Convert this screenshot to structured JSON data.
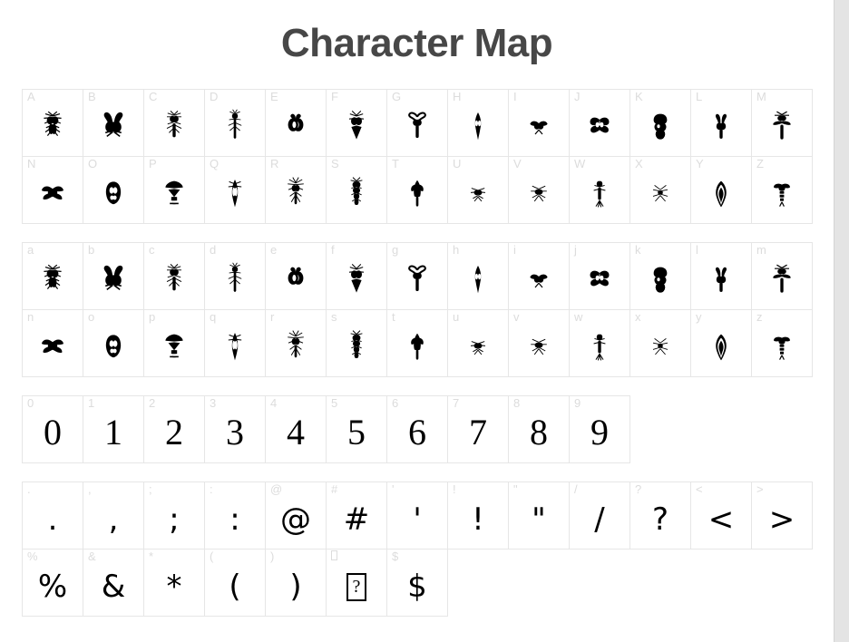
{
  "window": {
    "title": "Character Map"
  },
  "scrollbar": {
    "orientation": "vertical",
    "thumb_position_pct": 0,
    "thumb_size_pct": 100,
    "track_color": "#e4e4e4"
  },
  "colors": {
    "page_background": "#ffffff",
    "title_text": "#474747",
    "cell_border": "#e6e6e6",
    "cell_label": "#dcdcdc",
    "glyph": "#000000"
  },
  "blocks": [
    {
      "id": "uppercase",
      "name": "uppercase-letters",
      "style": "dingbat",
      "columns": 13,
      "rows": [
        [
          {
            "label": "A",
            "glyph": "A",
            "art": "ins-a"
          },
          {
            "label": "B",
            "glyph": "B",
            "art": "ins-b"
          },
          {
            "label": "C",
            "glyph": "C",
            "art": "ins-c"
          },
          {
            "label": "D",
            "glyph": "D",
            "art": "ins-d"
          },
          {
            "label": "E",
            "glyph": "E",
            "art": "ins-e"
          },
          {
            "label": "F",
            "glyph": "F",
            "art": "ins-f"
          },
          {
            "label": "G",
            "glyph": "G",
            "art": "ins-g"
          },
          {
            "label": "H",
            "glyph": "H",
            "art": "ins-h"
          },
          {
            "label": "I",
            "glyph": "I",
            "art": "ins-i"
          },
          {
            "label": "J",
            "glyph": "J",
            "art": "ins-j"
          },
          {
            "label": "K",
            "glyph": "K",
            "art": "ins-k"
          },
          {
            "label": "L",
            "glyph": "L",
            "art": "ins-l"
          },
          {
            "label": "M",
            "glyph": "M",
            "art": "ins-m"
          }
        ],
        [
          {
            "label": "N",
            "glyph": "N",
            "art": "ins-n"
          },
          {
            "label": "O",
            "glyph": "O",
            "art": "ins-o"
          },
          {
            "label": "P",
            "glyph": "P",
            "art": "ins-p"
          },
          {
            "label": "Q",
            "glyph": "Q",
            "art": "ins-q"
          },
          {
            "label": "R",
            "glyph": "R",
            "art": "ins-r"
          },
          {
            "label": "S",
            "glyph": "S",
            "art": "ins-s"
          },
          {
            "label": "T",
            "glyph": "T",
            "art": "ins-t"
          },
          {
            "label": "U",
            "glyph": "U",
            "art": "ins-u"
          },
          {
            "label": "V",
            "glyph": "V",
            "art": "ins-v"
          },
          {
            "label": "W",
            "glyph": "W",
            "art": "ins-w"
          },
          {
            "label": "X",
            "glyph": "X",
            "art": "ins-x"
          },
          {
            "label": "Y",
            "glyph": "Y",
            "art": "ins-y"
          },
          {
            "label": "Z",
            "glyph": "Z",
            "art": "ins-z"
          }
        ]
      ]
    },
    {
      "id": "lowercase",
      "name": "lowercase-letters",
      "style": "dingbat",
      "columns": 13,
      "rows": [
        [
          {
            "label": "a",
            "glyph": "a",
            "art": "ins-a"
          },
          {
            "label": "b",
            "glyph": "b",
            "art": "ins-b"
          },
          {
            "label": "c",
            "glyph": "c",
            "art": "ins-c"
          },
          {
            "label": "d",
            "glyph": "d",
            "art": "ins-d"
          },
          {
            "label": "e",
            "glyph": "e",
            "art": "ins-e"
          },
          {
            "label": "f",
            "glyph": "f",
            "art": "ins-f"
          },
          {
            "label": "g",
            "glyph": "g",
            "art": "ins-g"
          },
          {
            "label": "h",
            "glyph": "h",
            "art": "ins-h"
          },
          {
            "label": "i",
            "glyph": "i",
            "art": "ins-i"
          },
          {
            "label": "j",
            "glyph": "j",
            "art": "ins-j"
          },
          {
            "label": "k",
            "glyph": "k",
            "art": "ins-k"
          },
          {
            "label": "l",
            "glyph": "l",
            "art": "ins-l"
          },
          {
            "label": "m",
            "glyph": "m",
            "art": "ins-m"
          }
        ],
        [
          {
            "label": "n",
            "glyph": "n",
            "art": "ins-n"
          },
          {
            "label": "o",
            "glyph": "o",
            "art": "ins-o"
          },
          {
            "label": "p",
            "glyph": "p",
            "art": "ins-p"
          },
          {
            "label": "q",
            "glyph": "q",
            "art": "ins-q"
          },
          {
            "label": "r",
            "glyph": "r",
            "art": "ins-r"
          },
          {
            "label": "s",
            "glyph": "s",
            "art": "ins-s"
          },
          {
            "label": "t",
            "glyph": "t",
            "art": "ins-t"
          },
          {
            "label": "u",
            "glyph": "u",
            "art": "ins-u"
          },
          {
            "label": "v",
            "glyph": "v",
            "art": "ins-v"
          },
          {
            "label": "w",
            "glyph": "w",
            "art": "ins-w"
          },
          {
            "label": "x",
            "glyph": "x",
            "art": "ins-x"
          },
          {
            "label": "y",
            "glyph": "y",
            "art": "ins-y"
          },
          {
            "label": "z",
            "glyph": "z",
            "art": "ins-z"
          }
        ]
      ]
    },
    {
      "id": "digits",
      "name": "digits",
      "style": "text",
      "columns": 10,
      "rows": [
        [
          {
            "label": "0",
            "glyph": "0"
          },
          {
            "label": "1",
            "glyph": "1"
          },
          {
            "label": "2",
            "glyph": "2"
          },
          {
            "label": "3",
            "glyph": "3"
          },
          {
            "label": "4",
            "glyph": "4"
          },
          {
            "label": "5",
            "glyph": "5"
          },
          {
            "label": "6",
            "glyph": "6"
          },
          {
            "label": "7",
            "glyph": "7"
          },
          {
            "label": "8",
            "glyph": "8"
          },
          {
            "label": "9",
            "glyph": "9"
          }
        ]
      ]
    },
    {
      "id": "punctuation",
      "name": "punctuation-and-symbols",
      "style": "text",
      "columns": 13,
      "rows": [
        [
          {
            "label": ".",
            "glyph": "."
          },
          {
            "label": ",",
            "glyph": ","
          },
          {
            "label": ";",
            "glyph": ";"
          },
          {
            "label": ":",
            "glyph": ":"
          },
          {
            "label": "@",
            "glyph": "@"
          },
          {
            "label": "#",
            "glyph": "#"
          },
          {
            "label": "'",
            "glyph": "'"
          },
          {
            "label": "!",
            "glyph": "!"
          },
          {
            "label": "\"",
            "glyph": "\""
          },
          {
            "label": "/",
            "glyph": "/"
          },
          {
            "label": "?",
            "glyph": "?"
          },
          {
            "label": "<",
            "glyph": "<"
          },
          {
            "label": ">",
            "glyph": ">"
          }
        ],
        [
          {
            "label": "%",
            "glyph": "%"
          },
          {
            "label": "&",
            "glyph": "&"
          },
          {
            "label": "*",
            "glyph": "*"
          },
          {
            "label": "(",
            "glyph": "("
          },
          {
            "label": ")",
            "glyph": ")"
          },
          {
            "label": "",
            "glyph": "?",
            "missing": true
          },
          {
            "label": "$",
            "glyph": "$"
          }
        ]
      ]
    }
  ]
}
